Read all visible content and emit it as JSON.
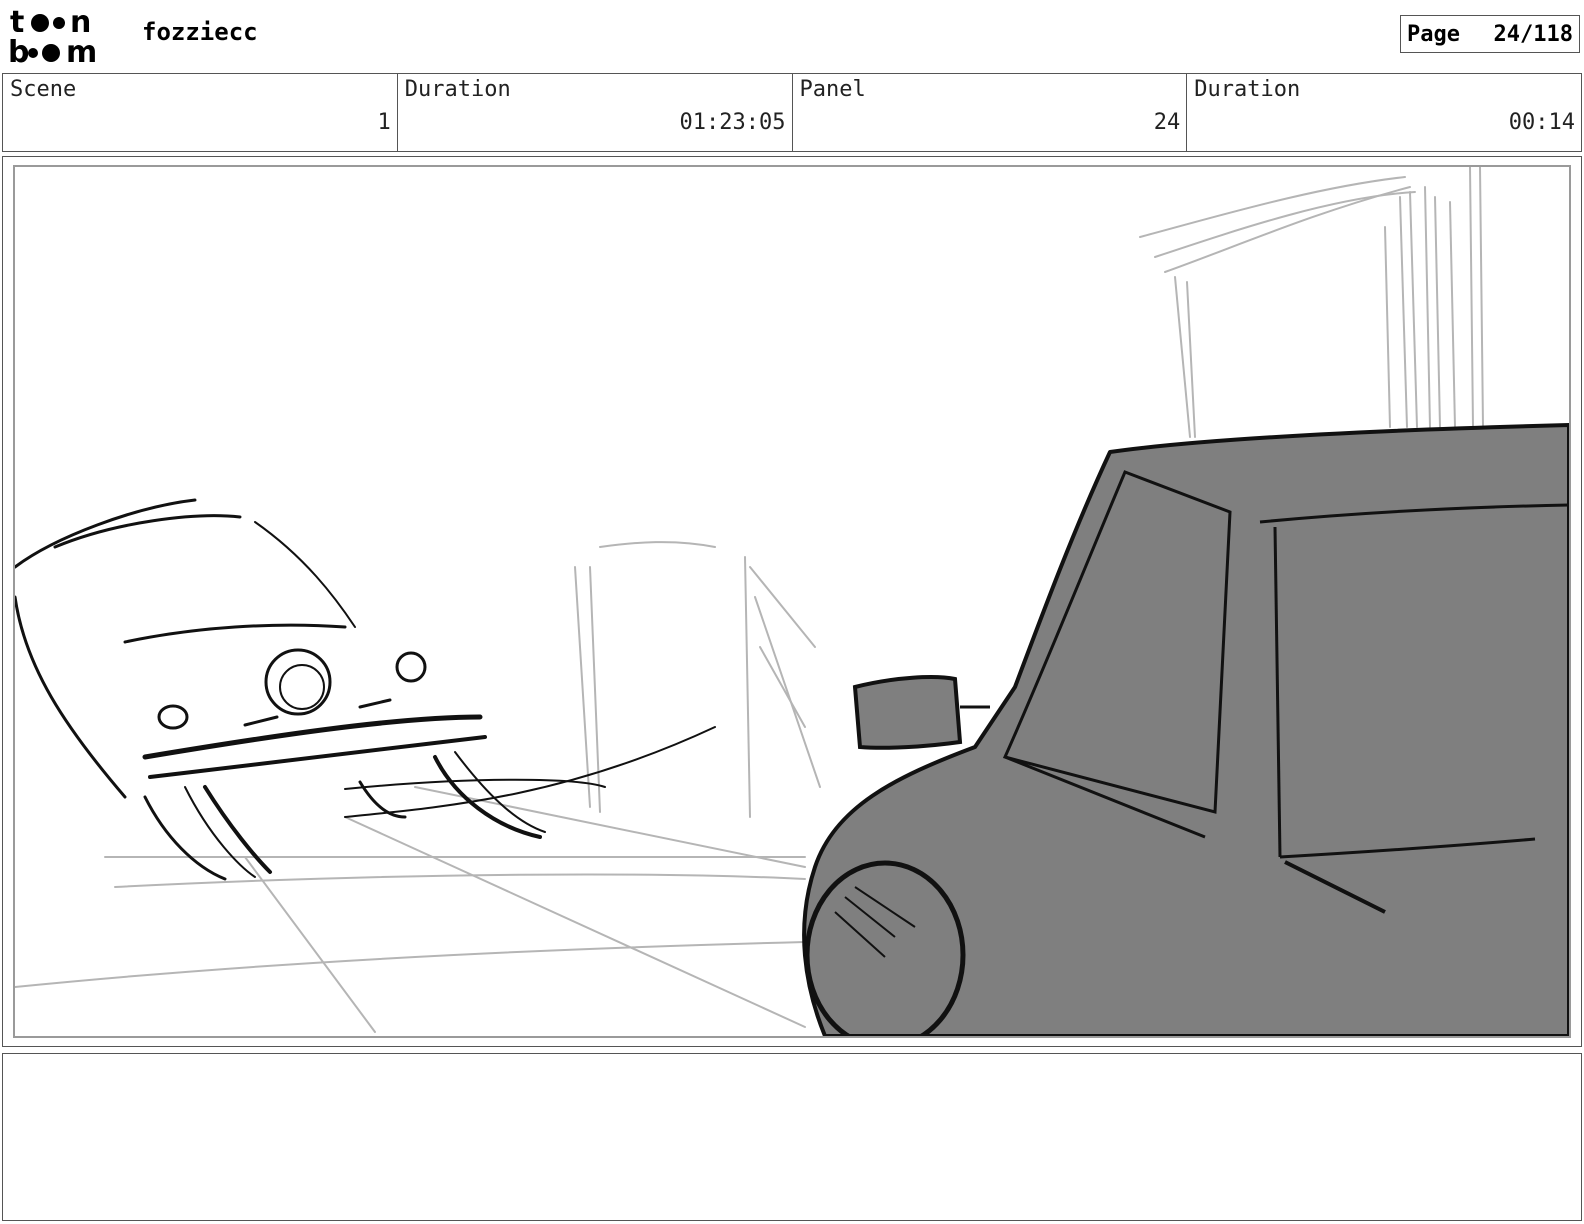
{
  "header": {
    "logo_text": "toon boom",
    "project_name": "fozziecc",
    "page_label": "Page",
    "page_value": "24/118"
  },
  "info": {
    "scene_label": "Scene",
    "scene_value": "1",
    "scene_duration_label": "Duration",
    "scene_duration_value": "01:23:05",
    "panel_label": "Panel",
    "panel_value": "24",
    "panel_duration_label": "Duration",
    "panel_duration_value": "00:14"
  },
  "colors": {
    "car_fill": "#7f7f7f",
    "sketch_light": "#b5b5b5",
    "ink": "#111111"
  },
  "notes": ""
}
